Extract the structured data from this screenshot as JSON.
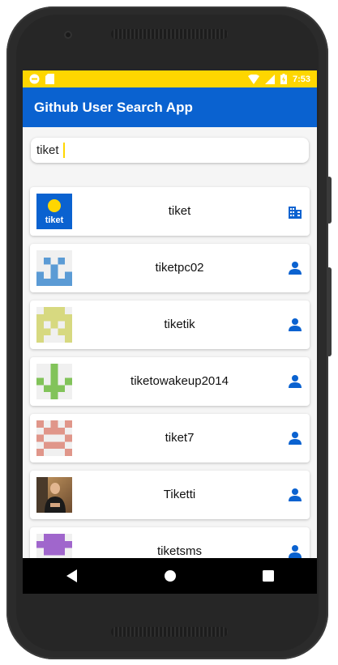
{
  "status_bar": {
    "time": "7:53",
    "background": "#ffd600"
  },
  "app_bar": {
    "title": "Github User Search App",
    "background": "#0a62d0"
  },
  "search": {
    "value": "tiket",
    "caret_color": "#ffd600"
  },
  "users": [
    {
      "login": "tiket",
      "type": "organization",
      "icon": "business-icon"
    },
    {
      "login": "tiketpc02",
      "type": "user",
      "icon": "person-icon"
    },
    {
      "login": "tiketik",
      "type": "user",
      "icon": "person-icon"
    },
    {
      "login": "tiketowakeup2014",
      "type": "user",
      "icon": "person-icon"
    },
    {
      "login": "tiket7",
      "type": "user",
      "icon": "person-icon"
    },
    {
      "login": "Tiketti",
      "type": "user",
      "icon": "person-icon"
    },
    {
      "login": "tiketsms",
      "type": "user",
      "icon": "person-icon"
    }
  ],
  "tiket_logo_text": "tiket",
  "icon_color": "#0a62d0",
  "nav": {
    "back": "back-icon",
    "home": "home-icon",
    "recents": "recents-icon"
  }
}
